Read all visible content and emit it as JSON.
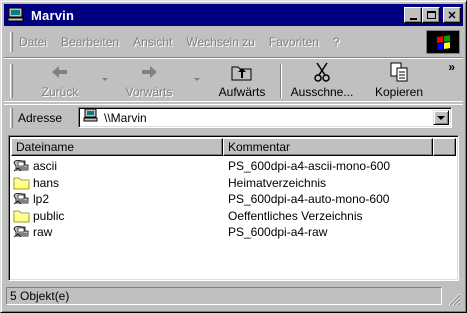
{
  "window": {
    "title": "Marvin",
    "minimize_icon": "minimize-icon",
    "maximize_icon": "maximize-icon",
    "close_icon": "close-icon",
    "close_label": "✕"
  },
  "menu": {
    "items": [
      {
        "label": "Datei"
      },
      {
        "label": "Bearbeiten"
      },
      {
        "label": "Ansicht"
      },
      {
        "label": "Wechseln zu"
      },
      {
        "label": "Favoriten"
      },
      {
        "label": "?"
      }
    ]
  },
  "toolbar": {
    "back_label": "Zurück",
    "forward_label": "Vorwärts",
    "up_label": "Aufwärts",
    "cut_label": "Ausschne...",
    "copy_label": "Kopieren",
    "more_label": "»"
  },
  "address": {
    "label": "Adresse",
    "value": "\\\\Marvin"
  },
  "list": {
    "columns": [
      "Dateiname",
      "Kommentar"
    ],
    "rows": [
      {
        "name": "ascii",
        "icon": "printer-icon",
        "comment": "PS_600dpi-a4-ascii-mono-600"
      },
      {
        "name": "hans",
        "icon": "folder-icon",
        "comment": "Heimatverzeichnis"
      },
      {
        "name": "lp2",
        "icon": "printer-icon",
        "comment": "PS_600dpi-a4-auto-mono-600"
      },
      {
        "name": "public",
        "icon": "folder-icon",
        "comment": "Oeffentliches Verzeichnis"
      },
      {
        "name": "raw",
        "icon": "printer-icon",
        "comment": "PS_600dpi-a4-raw"
      }
    ]
  },
  "status": {
    "text": "5 Objekt(e)"
  },
  "colors": {
    "titlebar": "#000080",
    "desktop": "#008080",
    "face": "#c0c0c0"
  }
}
